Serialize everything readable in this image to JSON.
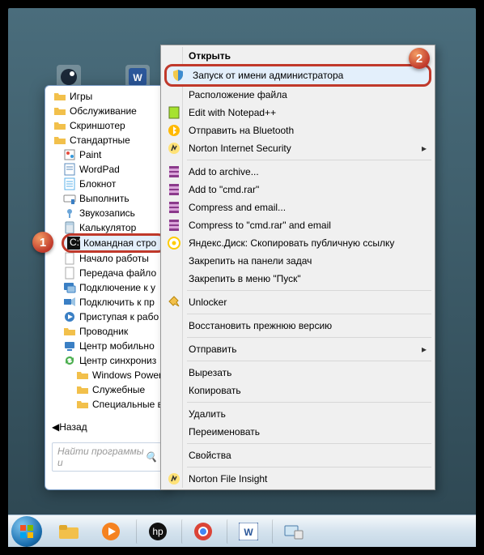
{
  "desktop": {
    "icons": [
      "steam",
      "word"
    ]
  },
  "startMenu": {
    "folders": [
      {
        "label": "Игры"
      },
      {
        "label": "Обслуживание"
      },
      {
        "label": "Скриншотер"
      },
      {
        "label": "Стандартные",
        "expanded": true
      }
    ],
    "standardItems": [
      {
        "icon": "paint",
        "label": "Paint"
      },
      {
        "icon": "wordpad",
        "label": "WordPad"
      },
      {
        "icon": "notepad",
        "label": "Блокнот"
      },
      {
        "icon": "run",
        "label": "Выполнить"
      },
      {
        "icon": "recorder",
        "label": "Звукозапись"
      },
      {
        "icon": "calc",
        "label": "Калькулятор"
      },
      {
        "icon": "cmd",
        "label": "Командная стро",
        "highlighted": true
      },
      {
        "icon": "file",
        "label": "Начало работы"
      },
      {
        "icon": "file",
        "label": "Передача файло"
      },
      {
        "icon": "rdp",
        "label": "Подключение к у"
      },
      {
        "icon": "proj",
        "label": "Подключить к пр"
      },
      {
        "icon": "start",
        "label": "Приступая к рабо"
      },
      {
        "icon": "explorer",
        "label": "Проводник"
      },
      {
        "icon": "mobility",
        "label": "Центр мобильно"
      },
      {
        "icon": "sync",
        "label": "Центр синхрониз"
      }
    ],
    "subFolders": [
      {
        "label": "Windows PowerSh"
      },
      {
        "label": "Служебные"
      },
      {
        "label": "Специальные во"
      }
    ],
    "back": "Назад",
    "searchPlaceholder": "Найти программы и"
  },
  "contextMenu": {
    "items": [
      {
        "label": "Открыть",
        "bold": true
      },
      {
        "label": "Запуск от имени администратора",
        "icon": "shield",
        "highlighted": true
      },
      {
        "label": "Расположение файла"
      },
      {
        "label": "Edit with Notepad++",
        "icon": "npp"
      },
      {
        "label": "Отправить на Bluetooth",
        "icon": "bt"
      },
      {
        "label": "Norton Internet Security",
        "icon": "norton",
        "arrow": true
      },
      {
        "sep": true
      },
      {
        "label": "Add to archive...",
        "icon": "rar"
      },
      {
        "label": "Add to \"cmd.rar\"",
        "icon": "rar"
      },
      {
        "label": "Compress and email...",
        "icon": "rar"
      },
      {
        "label": "Compress to \"cmd.rar\" and email",
        "icon": "rar"
      },
      {
        "label": "Яндекс.Диск: Скопировать публичную ссылку",
        "icon": "yadisk"
      },
      {
        "label": "Закрепить на панели задач"
      },
      {
        "label": "Закрепить в меню \"Пуск\""
      },
      {
        "sep": true
      },
      {
        "label": "Unlocker",
        "icon": "unlocker"
      },
      {
        "sep": true
      },
      {
        "label": "Восстановить прежнюю версию"
      },
      {
        "sep": true
      },
      {
        "label": "Отправить",
        "arrow": true
      },
      {
        "sep": true
      },
      {
        "label": "Вырезать"
      },
      {
        "label": "Копировать"
      },
      {
        "sep": true
      },
      {
        "label": "Удалить"
      },
      {
        "label": "Переименовать"
      },
      {
        "sep": true
      },
      {
        "label": "Свойства"
      },
      {
        "sep": true
      },
      {
        "label": "Norton File Insight",
        "icon": "norton"
      }
    ]
  },
  "badges": {
    "one": "1",
    "two": "2"
  },
  "taskbar": {
    "buttons": [
      "start",
      "explorer",
      "wmp",
      "hp",
      "chrome",
      "word",
      "devices"
    ]
  }
}
